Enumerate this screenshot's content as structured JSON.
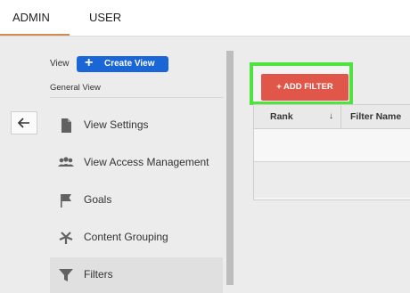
{
  "tabs": [
    {
      "label": "ADMIN"
    },
    {
      "label": "USER"
    }
  ],
  "sidebar": {
    "view_label": "View",
    "create_view_label": "Create View",
    "general_view": "General View",
    "items": [
      {
        "label": "View Settings"
      },
      {
        "label": "View Access Management"
      },
      {
        "label": "Goals"
      },
      {
        "label": "Content Grouping"
      },
      {
        "label": "Filters"
      }
    ]
  },
  "content": {
    "add_filter_label": "+ ADD FILTER",
    "table": {
      "columns": [
        "Rank",
        "Filter Name"
      ],
      "sort_indicator": "↓"
    }
  },
  "colors": {
    "accent_blue": "#1a66d6",
    "add_filter_red": "#e0574a",
    "highlight_green": "#4ee33e",
    "tab_underline": "#d18a52"
  }
}
